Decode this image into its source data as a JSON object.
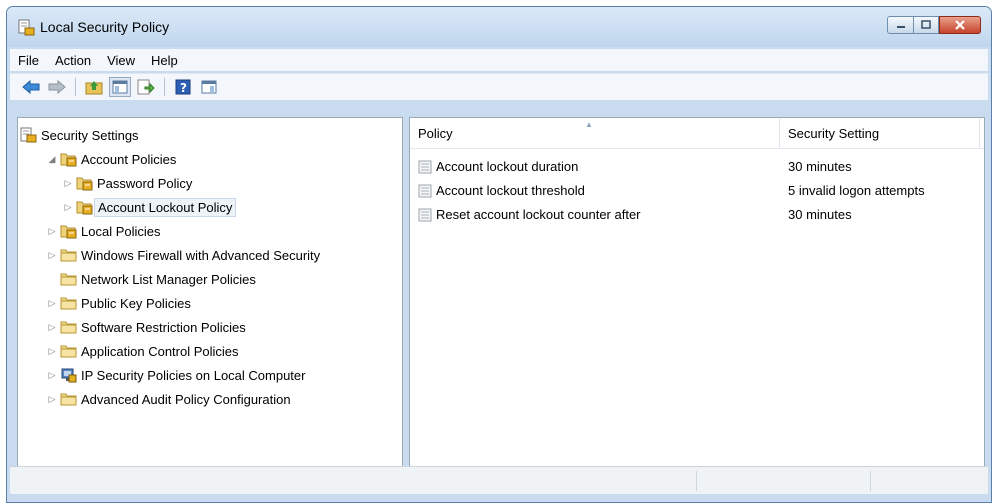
{
  "window": {
    "title": "Local Security Policy"
  },
  "menu": [
    "File",
    "Action",
    "View",
    "Help"
  ],
  "toolbar": {
    "icons": [
      "back-icon",
      "forward-icon",
      "up-folder-icon",
      "show-tree-icon",
      "export-list-icon",
      "help-icon",
      "console-icon"
    ]
  },
  "tree": [
    {
      "label": "Security Settings",
      "expander": "",
      "icon": "security-settings-icon",
      "level": 0
    },
    {
      "label": "Account Policies",
      "expander": "◢",
      "icon": "policy-folder-icon",
      "level": 1
    },
    {
      "label": "Password Policy",
      "expander": "▷",
      "icon": "policy-folder-icon",
      "level": 2
    },
    {
      "label": "Account Lockout Policy",
      "expander": "▷",
      "icon": "policy-folder-icon",
      "level": 2,
      "selected": true
    },
    {
      "label": "Local Policies",
      "expander": "▷",
      "icon": "policy-folder-icon",
      "level": 1
    },
    {
      "label": "Windows Firewall with Advanced Security",
      "expander": "▷",
      "icon": "folder-icon",
      "level": 1
    },
    {
      "label": "Network List Manager Policies",
      "expander": "",
      "icon": "folder-icon",
      "level": 1
    },
    {
      "label": "Public Key Policies",
      "expander": "▷",
      "icon": "folder-icon",
      "level": 1
    },
    {
      "label": "Software Restriction Policies",
      "expander": "▷",
      "icon": "folder-icon",
      "level": 1
    },
    {
      "label": "Application Control Policies",
      "expander": "▷",
      "icon": "folder-icon",
      "level": 1
    },
    {
      "label": "IP Security Policies on Local Computer",
      "expander": "▷",
      "icon": "ip-security-icon",
      "level": 1
    },
    {
      "label": "Advanced Audit Policy Configuration",
      "expander": "▷",
      "icon": "folder-icon",
      "level": 1
    }
  ],
  "list": {
    "columns": [
      "Policy",
      "Security Setting"
    ],
    "rows": [
      {
        "policy": "Account lockout duration",
        "setting": "30 minutes"
      },
      {
        "policy": "Account lockout threshold",
        "setting": "5 invalid logon attempts"
      },
      {
        "policy": "Reset account lockout counter after",
        "setting": "30 minutes"
      }
    ]
  },
  "colors": {
    "titlebar": "#c9dcef",
    "close_button": "#c7432b",
    "selection": "#eef3f9"
  }
}
